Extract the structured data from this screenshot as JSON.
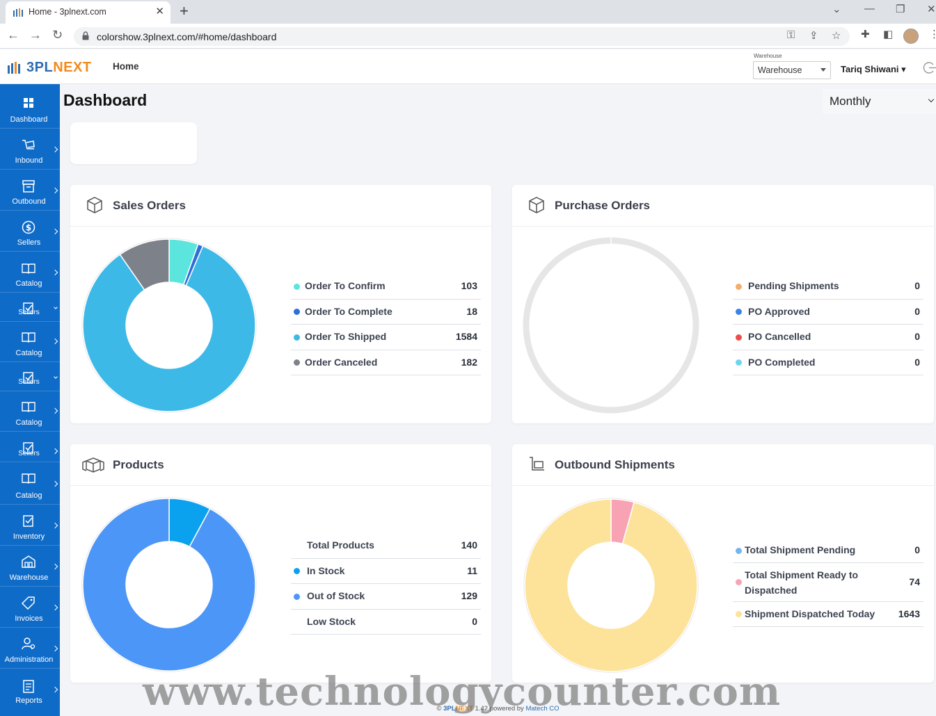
{
  "browser": {
    "tab_title": "Home - 3plnext.com",
    "url": "colorshow.3plnext.com/#home/dashboard"
  },
  "header": {
    "logo_part1": "3PL",
    "logo_part2": "NEXT",
    "nav_home": "Home",
    "warehouse_caption": "Warehouse",
    "warehouse_value": "Warehouse",
    "user_name": "Tariq Shiwani"
  },
  "sidebar": {
    "items": [
      {
        "label": "Dashboard",
        "icon": "dashboard-icon"
      },
      {
        "label": "Inbound",
        "icon": "inbound-icon"
      },
      {
        "label": "Outbound",
        "icon": "outbound-icon"
      },
      {
        "label": "Sellers",
        "icon": "dollar-icon"
      },
      {
        "label": "Catalog",
        "icon": "book-icon"
      },
      {
        "label": "Sellers",
        "icon": "seller-icon"
      },
      {
        "label": "Catalog",
        "icon": "book-icon"
      },
      {
        "label": "Sellers",
        "icon": "seller-icon"
      },
      {
        "label": "Catalog",
        "icon": "book-icon"
      },
      {
        "label": "Sellers",
        "icon": "seller-icon"
      },
      {
        "label": "Catalog",
        "icon": "book-icon"
      },
      {
        "label": "Inventory",
        "icon": "inventory-icon"
      },
      {
        "label": "Warehouse",
        "icon": "warehouse-icon"
      },
      {
        "label": "Invoices",
        "icon": "tag-icon"
      },
      {
        "label": "Administration",
        "icon": "admin-icon"
      },
      {
        "label": "Reports",
        "icon": "reports-icon"
      }
    ]
  },
  "main": {
    "title": "Dashboard",
    "period": "Monthly"
  },
  "cards": {
    "sales": {
      "title": "Sales Orders",
      "rows": [
        {
          "label": "Order To Confirm",
          "value": "103",
          "color": "#5ce5dc"
        },
        {
          "label": "Order To Complete",
          "value": "18",
          "color": "#2d6ed8"
        },
        {
          "label": "Order To Shipped",
          "value": "1584",
          "color": "#3cb9e6"
        },
        {
          "label": "Order Canceled",
          "value": "182",
          "color": "#7d8189"
        }
      ]
    },
    "purchase": {
      "title": "Purchase Orders",
      "rows": [
        {
          "label": "Pending Shipments",
          "value": "0",
          "color": "#f4ad6a"
        },
        {
          "label": "PO Approved",
          "value": "0",
          "color": "#3b82e8"
        },
        {
          "label": "PO Cancelled",
          "value": "0",
          "color": "#ee4b4b"
        },
        {
          "label": "PO Completed",
          "value": "0",
          "color": "#6fd4f2"
        }
      ]
    },
    "products": {
      "title": "Products",
      "rows": [
        {
          "label": "Total Products",
          "value": "140",
          "color": ""
        },
        {
          "label": "In Stock",
          "value": "11",
          "color": "#0aa2ef"
        },
        {
          "label": "Out of Stock",
          "value": "129",
          "color": "#4b96f6"
        },
        {
          "label": "Low Stock",
          "value": "0",
          "color": ""
        }
      ]
    },
    "outbound": {
      "title": "Outbound Shipments",
      "rows": [
        {
          "label": "Total Shipment Pending",
          "value": "0",
          "color": "#74b6ec"
        },
        {
          "label": "Total Shipment Ready to Dispatched",
          "value": "74",
          "color": "#f8a3b3"
        },
        {
          "label": "Shipment Dispatched Today",
          "value": "1643",
          "color": "#fde39a"
        }
      ]
    }
  },
  "chart_data": [
    {
      "type": "pie",
      "categories": [
        "Order To Confirm",
        "Order To Complete",
        "Order To Shipped",
        "Order Canceled"
      ],
      "values": [
        103,
        18,
        1584,
        182
      ],
      "colors": [
        "#5ce5dc",
        "#2d6ed8",
        "#3cb9e6",
        "#7d8189"
      ]
    },
    {
      "type": "pie",
      "categories": [
        "Pending Shipments",
        "PO Approved",
        "PO Cancelled",
        "PO Completed"
      ],
      "values": [
        0,
        0,
        0,
        0
      ],
      "colors": [
        "#f4ad6a",
        "#3b82e8",
        "#ee4b4b",
        "#6fd4f2"
      ]
    },
    {
      "type": "pie",
      "categories": [
        "In Stock",
        "Out of Stock"
      ],
      "values": [
        11,
        129
      ],
      "colors": [
        "#0aa2ef",
        "#4b96f6"
      ]
    },
    {
      "type": "pie",
      "categories": [
        "Total Shipment Pending",
        "Total Shipment Ready to Dispatched",
        "Shipment Dispatched Today"
      ],
      "values": [
        0,
        74,
        1643
      ],
      "colors": [
        "#74b6ec",
        "#f8a3b3",
        "#fde39a"
      ]
    }
  ],
  "footer": {
    "copyright": "©",
    "brand1": "3PL",
    "brand2": "NEXT",
    "version": "1.42",
    "powered": "powered by",
    "company": "Matech CO"
  },
  "watermark": "www.technologycounter.com"
}
